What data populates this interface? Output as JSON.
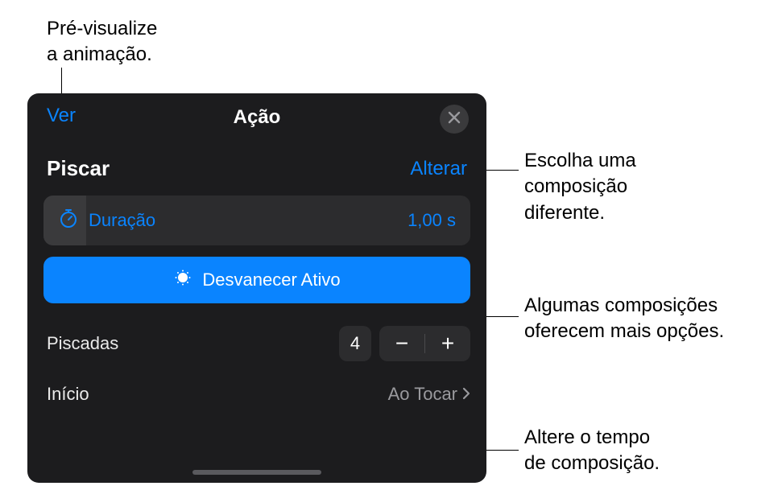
{
  "callouts": {
    "top": "Pré-visualize\na animação.",
    "c1": "Escolha uma\ncomposição\ndiferente.",
    "c2": "Algumas composições\noferecem mais opções.",
    "c3": "Altere o tempo\nde composição."
  },
  "panel": {
    "preview_label": "Ver",
    "title": "Ação",
    "effect_name": "Piscar",
    "change_label": "Alterar",
    "duration_label": "Duração",
    "duration_value": "1,00 s",
    "fade_button_label": "Desvanecer Ativo",
    "blinks_label": "Piscadas",
    "blinks_value": "4",
    "start_label": "Início",
    "start_value": "Ao Tocar"
  }
}
